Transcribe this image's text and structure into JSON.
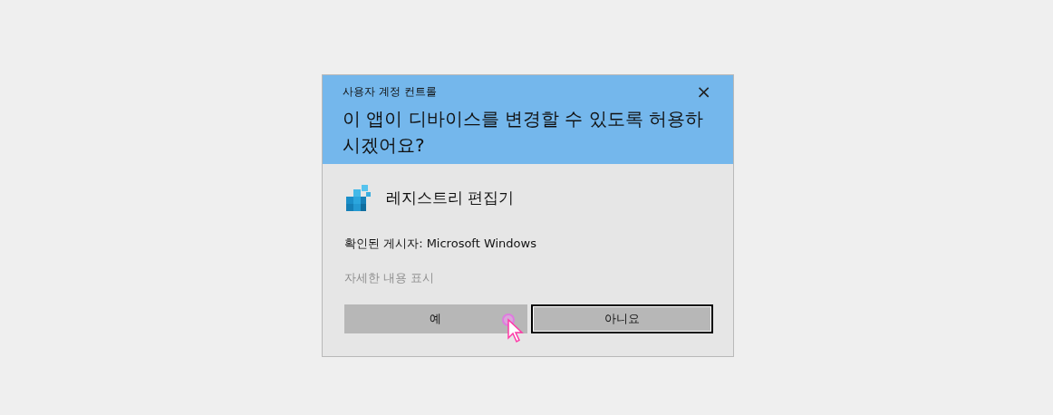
{
  "dialog": {
    "caption": "사용자 계정 컨트롤",
    "close": "×",
    "question": "이 앱이 디바이스를 변경할 수 있도록 허용하시겠어요?",
    "app": {
      "name": "레지스트리 편집기"
    },
    "publisher": "확인된 게시자: Microsoft Windows",
    "details_link": {
      "label": "자세한 내용 표시",
      "disabled": true
    },
    "buttons": [
      {
        "label": "예",
        "focused": false,
        "pointer": true
      },
      {
        "label": "아니요",
        "focused": true,
        "pointer": false
      }
    ]
  }
}
